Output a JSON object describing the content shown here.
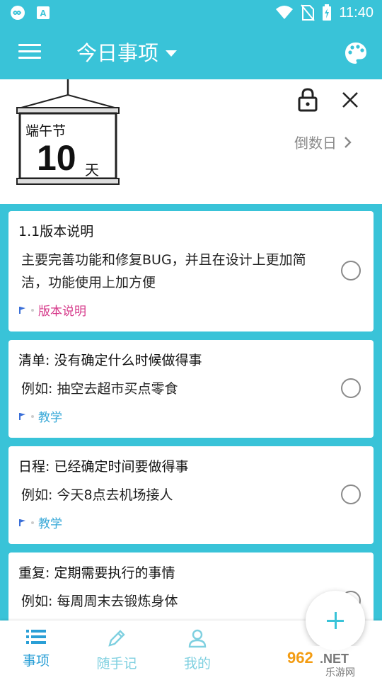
{
  "status_bar": {
    "time": "11:40"
  },
  "header": {
    "title": "今日事项"
  },
  "banner": {
    "festival": "端午节",
    "days": "10",
    "unit": "天",
    "countdown_label": "倒数日"
  },
  "tasks": [
    {
      "title": "1.1版本说明",
      "desc": "主要完善功能和修复BUG，并且在设计上更加简洁，功能使用上加方便",
      "tag": "版本说明",
      "tag_color": "#d6398a"
    },
    {
      "title": "清单: 没有确定什么时候做得事",
      "desc": "例如: 抽空去超市买点零食",
      "tag": "教学",
      "tag_color": "#39a9d8"
    },
    {
      "title": "日程: 已经确定时间要做得事",
      "desc": "例如: 今天8点去机场接人",
      "tag": "教学",
      "tag_color": "#39a9d8"
    },
    {
      "title": "重复: 定期需要执行的事情",
      "desc": "例如: 每周周末去锻炼身体",
      "tag": "",
      "tag_color": "#39a9d8"
    }
  ],
  "bottom_nav": [
    {
      "label": "事项",
      "icon": "list-icon",
      "active": true
    },
    {
      "label": "随手记",
      "icon": "pencil-icon",
      "active": false
    },
    {
      "label": "我的",
      "icon": "person-icon",
      "active": false
    }
  ],
  "watermark": {
    "brand": "962.NET",
    "sub": "乐游网"
  },
  "colors": {
    "accent": "#39c3d8",
    "active_nav": "#2a9fd6",
    "inactive_nav": "#7fd0e0"
  }
}
